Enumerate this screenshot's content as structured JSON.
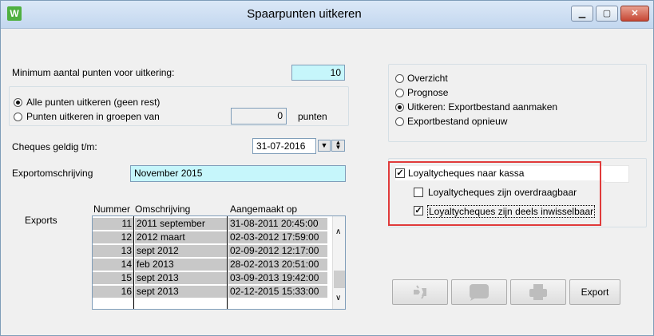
{
  "window": {
    "title": "Spaarpunten uitkeren",
    "app_icon_letter": "W",
    "min_icon": "minimize-icon",
    "max_icon": "maximize-icon",
    "close_icon": "close-icon"
  },
  "form": {
    "min_points_label": "Minimum aantal punten voor uitkering:",
    "min_points_value": "10",
    "radio_all": "Alle punten uitkeren (geen rest)",
    "radio_groups": "Punten uitkeren in groepen van",
    "groups_value": "0",
    "groups_unit": "punten",
    "cheques_label": "Cheques geldig t/m:",
    "cheques_date": "31-07-2016",
    "export_desc_label": "Exportomschrijving",
    "export_desc_value": "November 2015",
    "exports_label": "Exports"
  },
  "options": {
    "overview": "Overzicht",
    "prognosis": "Prognose",
    "payout": "Uitkeren: Exportbestand aanmaken",
    "export_again": "Exportbestand opnieuw",
    "selected": "payout"
  },
  "loyalty": {
    "to_register": "Loyaltycheques naar kassa",
    "transferable": "Loyaltycheques zijn overdraagbaar",
    "partially_exchangeable": "Loyaltycheques zijn deels inwisselbaar"
  },
  "table": {
    "headers": [
      "Nummer",
      "Omschrijving",
      "Aangemaakt op"
    ],
    "rows": [
      {
        "nummer": "11",
        "omschrijving": "2011 september",
        "aangemaakt": "31-08-2011 20:45:00"
      },
      {
        "nummer": "12",
        "omschrijving": "2012 maart",
        "aangemaakt": "02-03-2012 17:59:00"
      },
      {
        "nummer": "13",
        "omschrijving": "sept 2012",
        "aangemaakt": "02-09-2012 12:17:00"
      },
      {
        "nummer": "14",
        "omschrijving": "feb 2013",
        "aangemaakt": "28-02-2013 20:51:00"
      },
      {
        "nummer": "15",
        "omschrijving": "sept 2013",
        "aangemaakt": "03-09-2013 19:42:00"
      },
      {
        "nummer": "16",
        "omschrijving": "sept 2013",
        "aangemaakt": "02-12-2015 15:33:00"
      }
    ]
  },
  "buttons": {
    "export_label": "Export",
    "icon1": "broken-link-icon",
    "icon2": "speech-bubble-icon",
    "icon3": "printer-icon"
  },
  "colors": {
    "accent_cyan": "#c6f6fb",
    "highlight_red": "#e03a3a",
    "row_grey": "#c8c8c8"
  }
}
